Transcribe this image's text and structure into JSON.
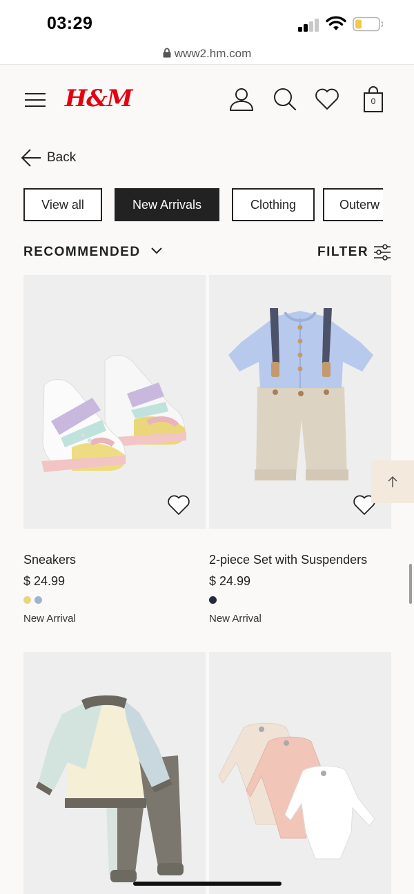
{
  "status_bar": {
    "time": "03:29"
  },
  "browser": {
    "url": "www2.hm.com"
  },
  "header": {
    "logo_text": "H&M",
    "bag_count": "0",
    "brand_color": "#e50010"
  },
  "navigation": {
    "back_label": "Back"
  },
  "categories": [
    {
      "label": "View all",
      "active": false
    },
    {
      "label": "New Arrivals",
      "active": true
    },
    {
      "label": "Clothing",
      "active": false
    },
    {
      "label": "Outerw",
      "active": false
    }
  ],
  "sort": {
    "label": "RECOMMENDED"
  },
  "filter": {
    "label": "FILTER"
  },
  "products": [
    {
      "name": "Sneakers",
      "price": "$ 24.99",
      "badge": "New Arrival",
      "swatches": [
        "#ead57a",
        "#9fb4cc"
      ],
      "image": "sneakers"
    },
    {
      "name": "2-piece Set with Suspenders",
      "price": "$ 24.99",
      "badge": "New Arrival",
      "swatches": [
        "#262b3d"
      ],
      "image": "suspender-set"
    },
    {
      "name": "",
      "price": "",
      "badge": "",
      "swatches": [],
      "image": "sweatshirt-set"
    },
    {
      "name": "",
      "price": "",
      "badge": "",
      "swatches": [],
      "image": "bodysuits"
    }
  ]
}
